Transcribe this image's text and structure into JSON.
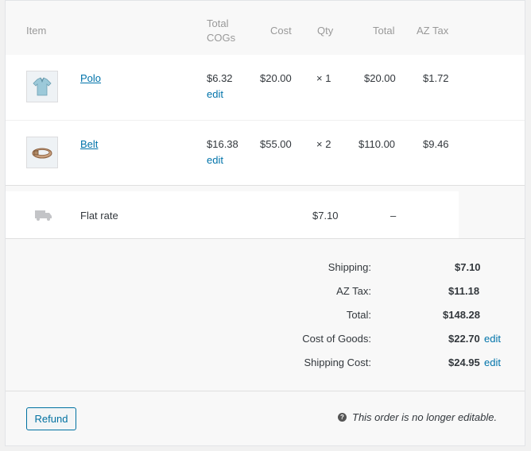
{
  "header": {
    "item": "Item",
    "total_cogs_line1": "Total",
    "total_cogs_line2": "COGs",
    "cost": "Cost",
    "qty": "Qty",
    "total": "Total",
    "tax": "AZ Tax"
  },
  "items": [
    {
      "name": "Polo",
      "cogs": "$6.32",
      "edit": "edit",
      "cost": "$20.00",
      "qty": "× 1",
      "total": "$20.00",
      "tax": "$1.72",
      "icon": "polo-shirt-icon"
    },
    {
      "name": "Belt",
      "cogs": "$16.38",
      "edit": "edit",
      "cost": "$55.00",
      "qty": "× 2",
      "total": "$110.00",
      "tax": "$9.46",
      "icon": "belt-icon"
    }
  ],
  "shipping_line": {
    "name": "Flat rate",
    "cost": "$7.10",
    "tax": "–",
    "icon": "truck-icon"
  },
  "totals": {
    "shipping_label": "Shipping:",
    "shipping_value": "$7.10",
    "tax_label": "AZ Tax:",
    "tax_value": "$11.18",
    "total_label": "Total:",
    "total_value": "$148.28",
    "cog_label": "Cost of Goods:",
    "cog_value": "$22.70",
    "cog_edit": "edit",
    "shipcost_label": "Shipping Cost:",
    "shipcost_value": "$24.95",
    "shipcost_edit": "edit"
  },
  "footer": {
    "refund_label": "Refund",
    "notice": "This order is no longer editable.",
    "notice_icon": "?"
  }
}
